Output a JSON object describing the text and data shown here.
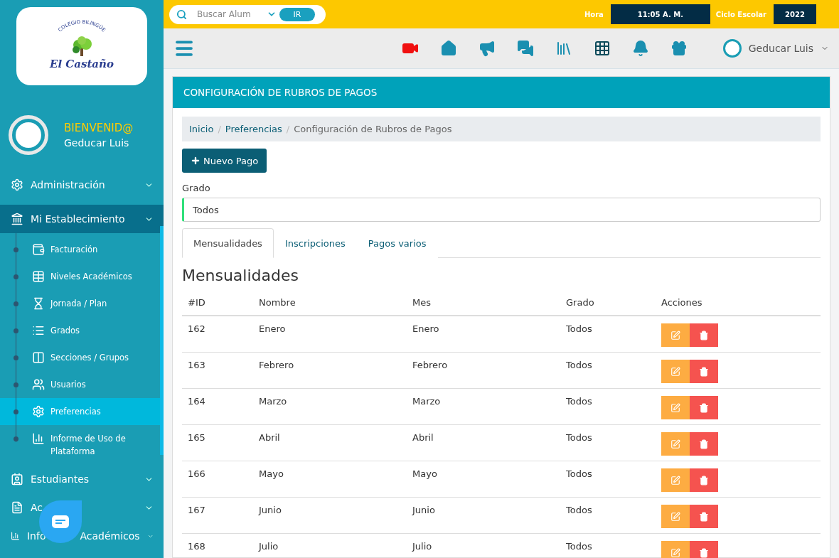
{
  "topbar": {
    "search": {
      "placeholder": "Buscar Alum",
      "button": "IR"
    },
    "clock": {
      "label": "Hora",
      "value": "11:05 A. M."
    },
    "cycle": {
      "label": "Ciclo Escolar",
      "value": "2022"
    }
  },
  "navbar": {
    "user": "Geducar Luis"
  },
  "sidebar": {
    "logo": {
      "caption": "COLEGIO BILINGÜE",
      "name": "El Castaño"
    },
    "greeting": "BIENVENID@",
    "user_name": "Geducar Luis",
    "items": [
      {
        "label": "Administración",
        "expanded": false
      },
      {
        "label": "Mi Establecimiento",
        "expanded": true,
        "children": [
          {
            "label": "Facturación",
            "selected": false
          },
          {
            "label": "Niveles Académicos",
            "selected": false
          },
          {
            "label": "Jornada / Plan",
            "selected": false
          },
          {
            "label": "Grados",
            "selected": false
          },
          {
            "label": "Secciones / Grupos",
            "selected": false
          },
          {
            "label": "Usuarios",
            "selected": false
          },
          {
            "label": "Preferencias",
            "selected": true
          },
          {
            "label": "Informe de Uso de Plataforma",
            "selected": false
          }
        ]
      },
      {
        "label": "Estudiantes",
        "expanded": false
      },
      {
        "label": "Ac",
        "expanded": false
      },
      {
        "label": "Info",
        "label_tail": "Académicos",
        "expanded": false
      }
    ]
  },
  "card": {
    "title": "CONFIGURACIÓN DE RUBROS DE PAGOS",
    "breadcrumb": {
      "separator": "/",
      "items": [
        {
          "label": "Inicio",
          "link": true
        },
        {
          "label": "Preferencias",
          "link": true
        },
        {
          "label": "Configuración de Rubros de Pagos",
          "link": false
        }
      ]
    },
    "new_button": "Nuevo Pago",
    "grade": {
      "label": "Grado",
      "value": "Todos"
    },
    "tabs": [
      {
        "label": "Mensualidades",
        "selected": true
      },
      {
        "label": "Inscripciones",
        "selected": false
      },
      {
        "label": "Pagos varios",
        "selected": false
      }
    ],
    "section_title": "Mensualidades",
    "table": {
      "columns": [
        "#ID",
        "Nombre",
        "Mes",
        "Grado",
        "Acciones"
      ],
      "rows": [
        [
          "162",
          "Enero",
          "Enero",
          "Todos"
        ],
        [
          "163",
          "Febrero",
          "Febrero",
          "Todos"
        ],
        [
          "164",
          "Marzo",
          "Marzo",
          "Todos"
        ],
        [
          "165",
          "Abril",
          "Abril",
          "Todos"
        ],
        [
          "166",
          "Mayo",
          "Mayo",
          "Todos"
        ],
        [
          "167",
          "Junio",
          "Junio",
          "Todos"
        ],
        [
          "168",
          "Julio",
          "Julio",
          "Todos"
        ]
      ]
    }
  }
}
